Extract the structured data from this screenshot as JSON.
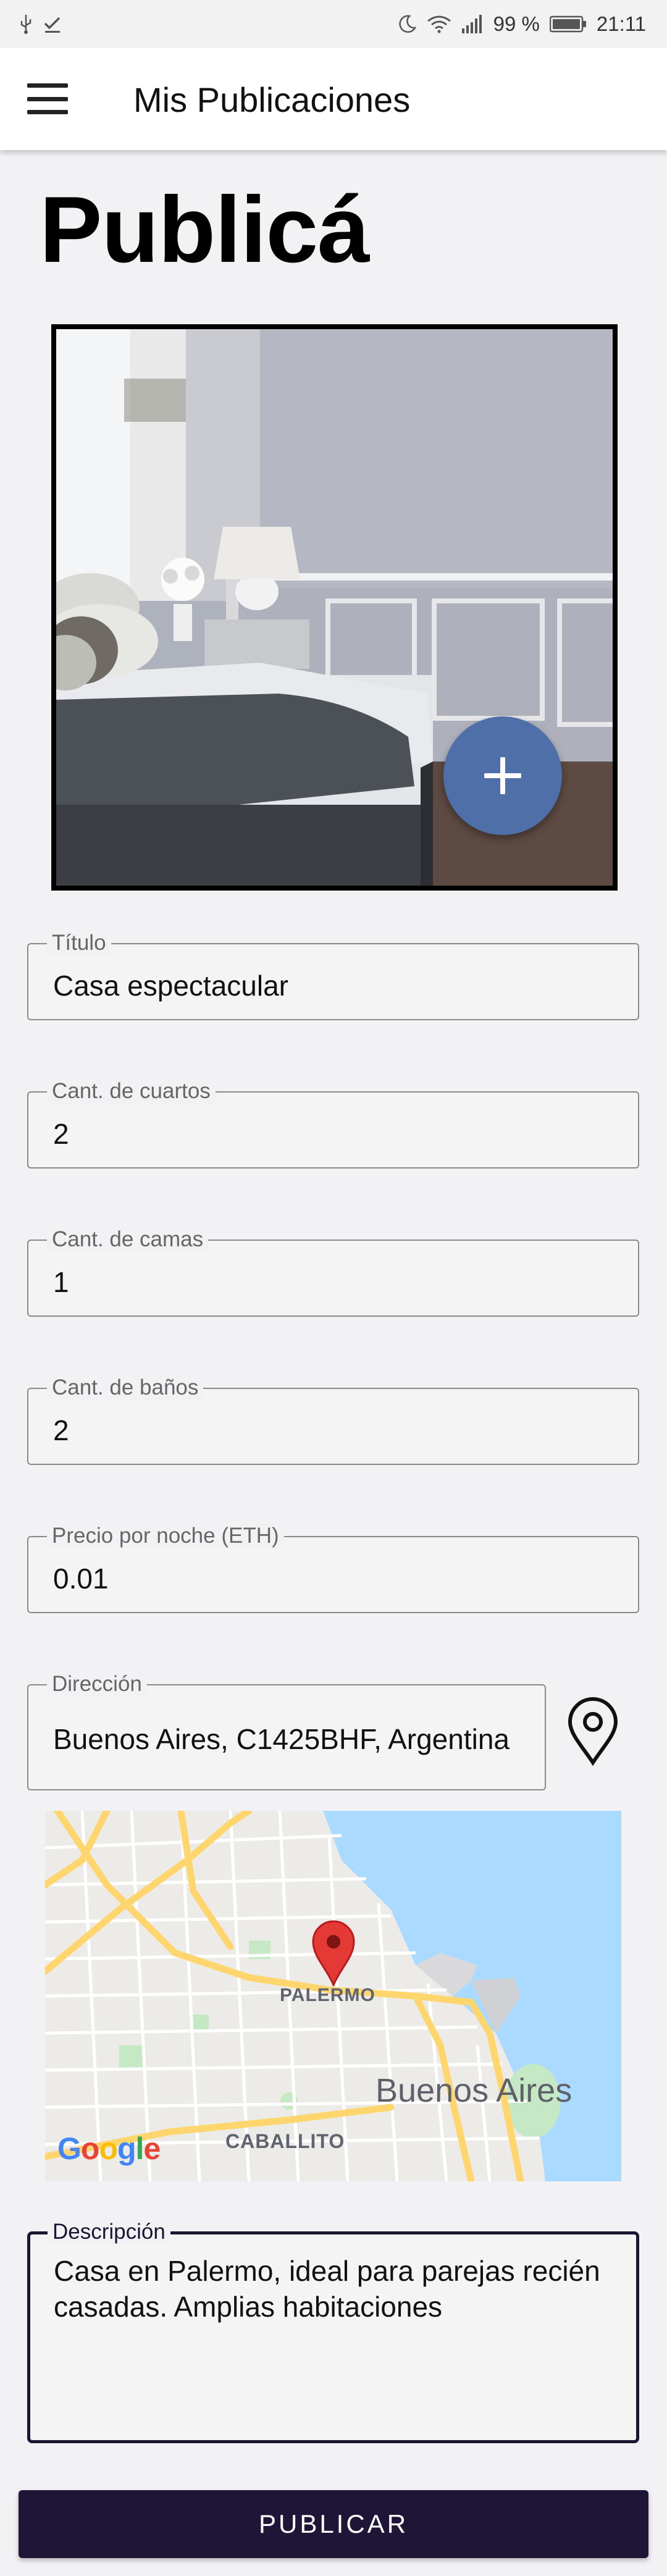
{
  "status_bar": {
    "battery": "99 %",
    "time": "21:11",
    "icons": [
      "usb-icon",
      "check-download-icon",
      "moon-icon",
      "wifi-icon",
      "signal-icon",
      "battery-icon"
    ]
  },
  "app_bar": {
    "title": "Mis Publicaciones",
    "menu_icon": "hamburger-menu-icon"
  },
  "heading": "Publicá",
  "photo": {
    "add_button_icon": "plus-icon",
    "accent_color": "#4f6fa8"
  },
  "form": {
    "fields": [
      {
        "label": "Título",
        "value": "Casa espectacular"
      },
      {
        "label": "Cant. de cuartos",
        "value": "2"
      },
      {
        "label": "Cant. de camas",
        "value": "1"
      },
      {
        "label": "Cant. de baños",
        "value": "2"
      },
      {
        "label": "Precio por noche (ETH)",
        "value": "0.01"
      }
    ],
    "address": {
      "label": "Dirección",
      "value": "Buenos Aires, C1425BHF, Argentina",
      "pin_icon": "location-pin-icon"
    },
    "description": {
      "label": "Descripción",
      "value": "Casa en Palermo, ideal para parejas recién casadas. Amplias habitaciones"
    }
  },
  "map": {
    "labels": {
      "palermo": "PALERMO",
      "city": "Buenos Aires",
      "caballito": "CABALLITO"
    },
    "logo": "Google",
    "marker_color": "#e53935",
    "water_color": "#aadaff"
  },
  "submit_button": {
    "label": "PUBLICAR",
    "color": "#1f1536"
  }
}
